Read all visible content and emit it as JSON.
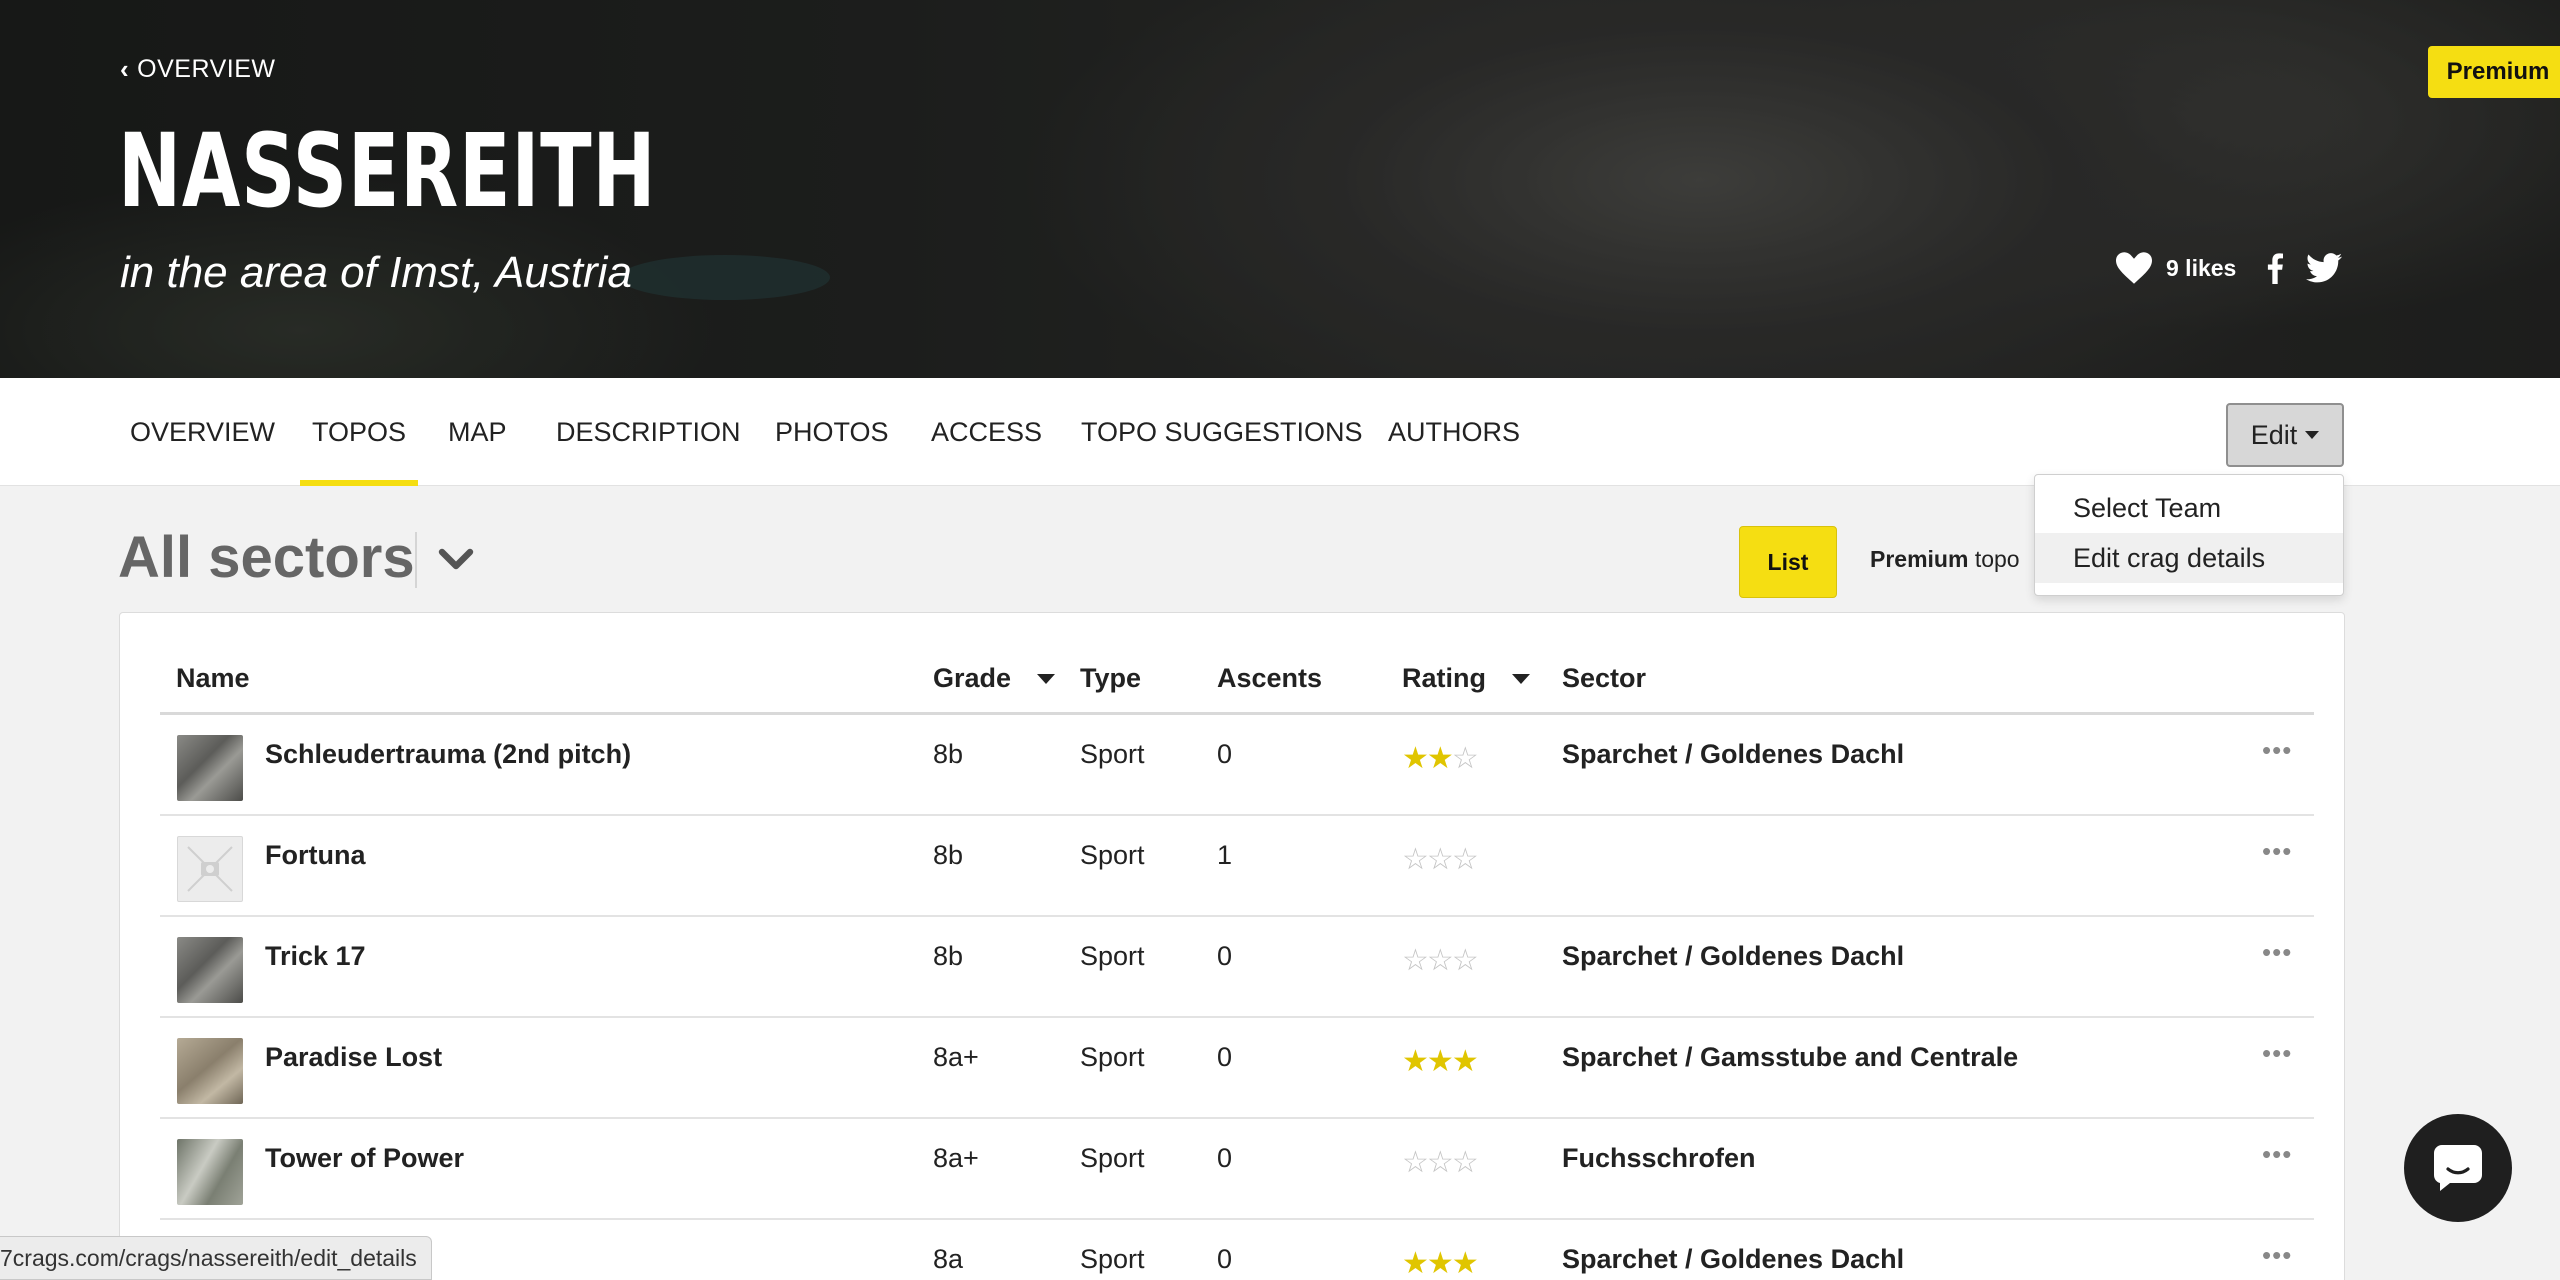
{
  "hero": {
    "back_label": "OVERVIEW",
    "title": "NASSEREITH",
    "subtitle": "in the area of Imst, Austria",
    "premium_badge": "Premium",
    "likes": "9 likes"
  },
  "nav": {
    "tabs": [
      {
        "label": "OVERVIEW",
        "active": false
      },
      {
        "label": "TOPOS",
        "active": true
      },
      {
        "label": "MAP",
        "active": false
      },
      {
        "label": "DESCRIPTION",
        "active": false
      },
      {
        "label": "PHOTOS",
        "active": false
      },
      {
        "label": "ACCESS",
        "active": false
      },
      {
        "label": "TOPO SUGGESTIONS",
        "active": false
      },
      {
        "label": "AUTHORS",
        "active": false
      }
    ],
    "edit_label": "Edit",
    "dropdown": [
      "Select Team",
      "Edit crag details"
    ]
  },
  "toolbar": {
    "sector_title": "All sectors",
    "list_label": "List",
    "premium_bold": "Premium",
    "premium_rest": " topo"
  },
  "table": {
    "headers": {
      "name": "Name",
      "grade": "Grade",
      "type": "Type",
      "ascents": "Ascents",
      "rating": "Rating",
      "sector": "Sector"
    },
    "rows": [
      {
        "name": "Schleudertrauma (2nd pitch)",
        "grade": "8b",
        "type": "Sport",
        "ascents": "0",
        "rating": 2,
        "sector": "Sparchet / Goldenes Dachl"
      },
      {
        "name": "Fortuna",
        "grade": "8b",
        "type": "Sport",
        "ascents": "1",
        "rating": 0,
        "sector": ""
      },
      {
        "name": "Trick 17",
        "grade": "8b",
        "type": "Sport",
        "ascents": "0",
        "rating": 0,
        "sector": "Sparchet / Goldenes Dachl"
      },
      {
        "name": "Paradise Lost",
        "grade": "8a+",
        "type": "Sport",
        "ascents": "0",
        "rating": 3,
        "sector": "Sparchet / Gamsstube and Centrale"
      },
      {
        "name": "Tower of Power",
        "grade": "8a+",
        "type": "Sport",
        "ascents": "0",
        "rating": 0,
        "sector": "Fuchsschrofen"
      },
      {
        "name": "",
        "grade": "8a",
        "type": "Sport",
        "ascents": "0",
        "rating": 3,
        "sector": "Sparchet / Goldenes Dachl"
      }
    ]
  },
  "status": {
    "url": "7crags.com/crags/nassereith/edit_details"
  },
  "colors": {
    "accent": "#f5de12",
    "star_on": "#e0c500",
    "star_off": "#c4c4c4"
  }
}
